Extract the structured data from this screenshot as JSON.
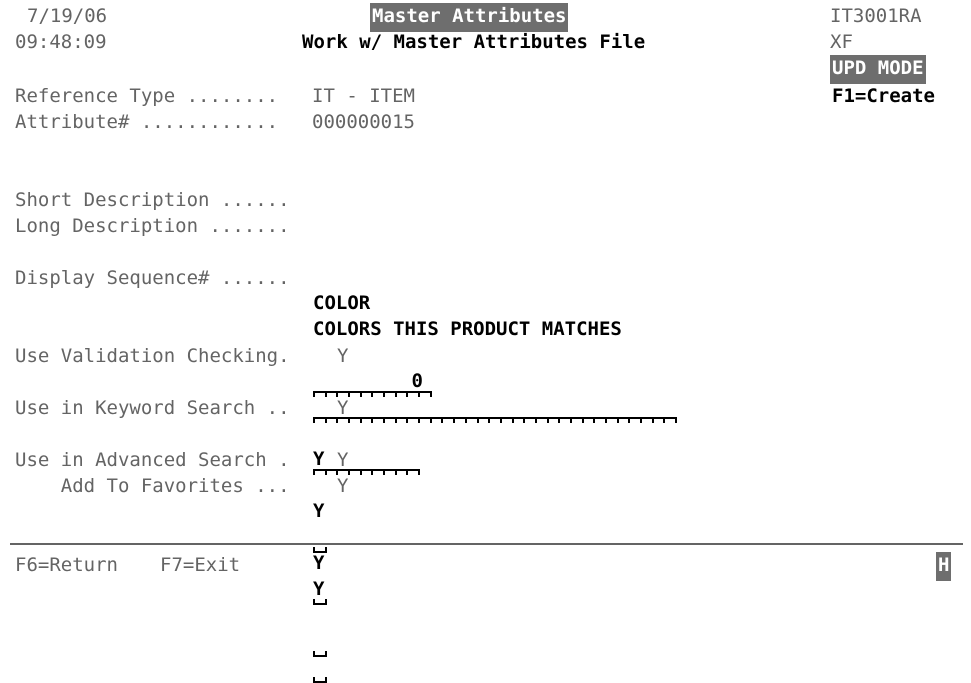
{
  "screen": {
    "program_id": "IT3001RA",
    "workstation": "XF",
    "mode_indicator": "UPD MODE",
    "mode_key_hint": "F1=Create",
    "date": "7/19/06",
    "time": "09:48:09",
    "title": "Master Attributes",
    "subtitle": "Work w/ Master Attributes File",
    "system_indicator": "H"
  },
  "header_fields": [
    {
      "label": "Reference Type ........",
      "value": "IT - ITEM"
    },
    {
      "label": "Attribute# ............",
      "value": "000000015"
    }
  ],
  "entry_fields": [
    {
      "label": "Short Description ......",
      "value": "COLOR",
      "length": 10,
      "align": "left"
    },
    {
      "label": "Long Description .......",
      "value": "COLORS THIS PRODUCT MATCHES",
      "length": 30,
      "align": "left"
    },
    {
      "label": "Display Sequence# ......",
      "value": "0",
      "length": 9,
      "align": "right"
    }
  ],
  "flag_fields": [
    {
      "label": "Use Validation Checking.",
      "value": "Y",
      "allowed": "Y"
    },
    {
      "label": "Use in Keyword Search ..",
      "value": "Y",
      "allowed": "Y"
    },
    {
      "label": "Use in Advanced Search .",
      "value": "Y",
      "allowed": "Y"
    },
    {
      "label": "    Add To Favorites ...",
      "value": "Y",
      "allowed": "Y"
    }
  ],
  "function_keys": [
    {
      "label": "F6=Return"
    },
    {
      "label": "F7=Exit"
    }
  ],
  "colors": {
    "background": "#ffffff",
    "protected_text": "#646464",
    "high_intensity_text": "#000000",
    "reverse_background": "#6e6e6e",
    "reverse_text": "#ffffff"
  }
}
